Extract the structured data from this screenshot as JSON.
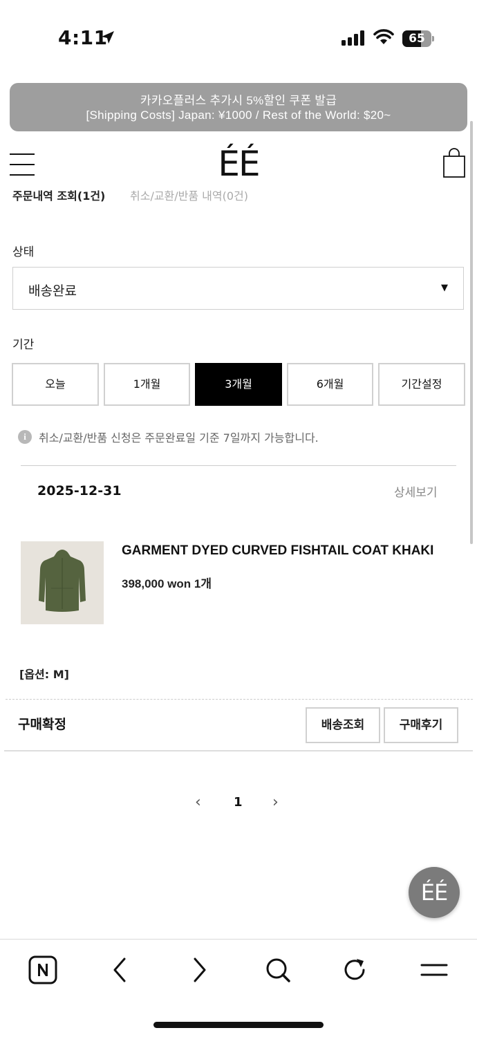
{
  "status_bar": {
    "time": "4:11",
    "battery": "65",
    "battery_level": 0.65
  },
  "banner": {
    "line1": "카카오플러스 추가시 5%할인 쿠폰 발급",
    "line2": "[Shipping Costs] Japan: ¥1000 / Rest of the World: $20~"
  },
  "header": {
    "logo": "ÉÉ"
  },
  "tabs": {
    "orders": "주문내역 조회(1건)",
    "cancels": "취소/교환/반품 내역(0건)"
  },
  "filters": {
    "status_label": "상태",
    "status_value": "배송완료",
    "period_label": "기간",
    "periods": [
      "오늘",
      "1개월",
      "3개월",
      "6개월",
      "기간설정"
    ],
    "active_period": "3개월"
  },
  "notice": "취소/교환/반품 신청은 주문완료일 기준 7일까지 가능합니다.",
  "order": {
    "date": "2025-12-31",
    "detail_link": "상세보기",
    "product_name": "GARMENT DYED CURVED FISHTAIL COAT KHAKI",
    "price": "398,000 won 1개",
    "option": "[옵션: M]",
    "status": "구매확정",
    "actions": [
      "배송조회",
      "구매후기"
    ]
  },
  "pagination": {
    "current": "1"
  },
  "fab": {
    "label": "ÉÉ"
  },
  "colors": {
    "banner_bg": "#9e9e9e",
    "active_period_bg": "#000000",
    "fab_bg": "#7b7b7b"
  },
  "bottom_nav": [
    "naver-n-icon",
    "back-arrow-icon",
    "forward-arrow-icon",
    "search-icon",
    "refresh-icon",
    "menu-icon"
  ]
}
